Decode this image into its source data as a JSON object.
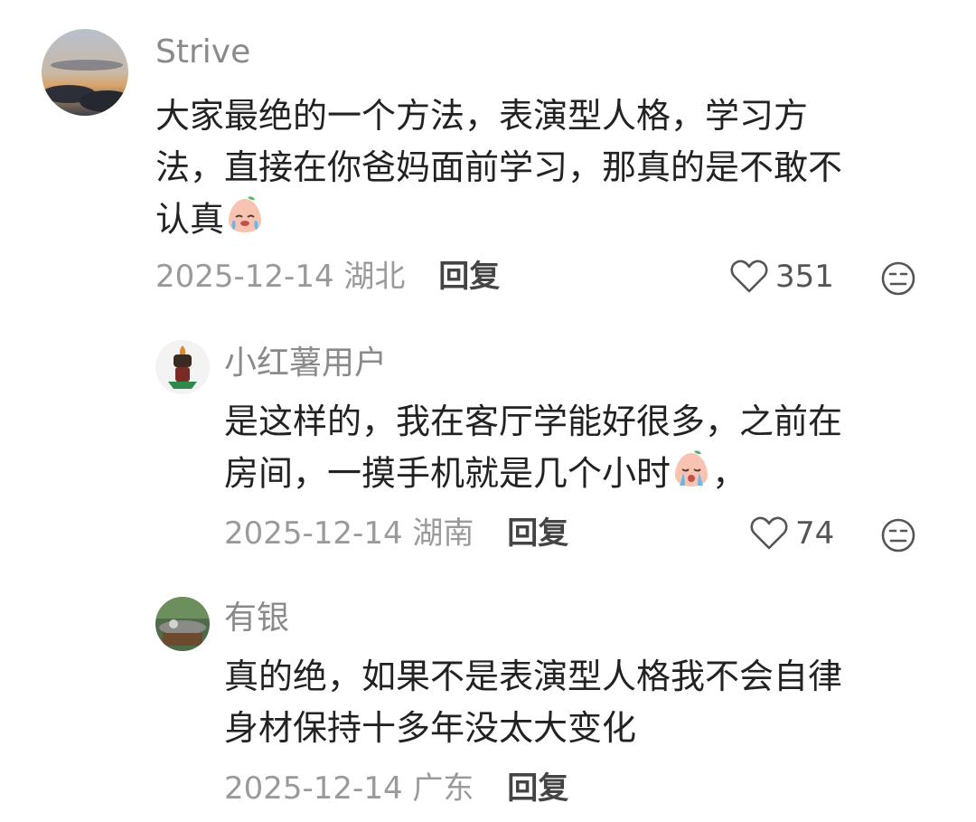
{
  "comments": [
    {
      "user": "Strive",
      "lines": [
        "大家最绝的一个方法，表演型人格，学习方",
        "法，直接在你爸妈面前学习，那真的是不敢不",
        "认真"
      ],
      "date": "2025-12-14",
      "region": "湖北",
      "reply_label": "回复",
      "likes": "351"
    },
    {
      "user": "小红薯用户",
      "lines": [
        "是这样的，我在客厅学能好很多，之前在",
        "房间，一摸手机就是几个小时"
      ],
      "trailing": "，",
      "date": "2025-12-14",
      "region": "湖南",
      "reply_label": "回复",
      "likes": "74"
    },
    {
      "user": "有银",
      "lines": [
        "真的绝，如果不是表演型人格我不会自律",
        "身材保持十多年没太大变化"
      ],
      "date": "2025-12-14",
      "region": "广东",
      "reply_label": "回复"
    }
  ],
  "icons": {
    "like": "heart-outline-icon",
    "dislike": "neutral-face-icon",
    "emoji_laugh_cry": "laugh-cry-emoji",
    "emoji_cry": "cry-emoji"
  },
  "colors": {
    "name": "#8a8a8a",
    "text": "#222222",
    "meta": "#9a9a9a",
    "reply": "#444444"
  }
}
